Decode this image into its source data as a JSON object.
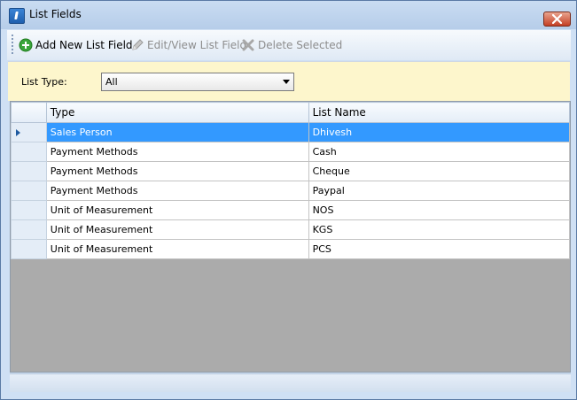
{
  "window": {
    "title": "List Fields",
    "close_label": "Close"
  },
  "toolbar": {
    "add_label": "Add New List Field",
    "edit_label": "Edit/View List Field",
    "delete_label": "Delete Selected"
  },
  "filter": {
    "label": "List Type:",
    "selected": "All"
  },
  "grid": {
    "columns": [
      "Type",
      "List Name"
    ],
    "rows": [
      {
        "type": "Sales Person",
        "name": "Dhivesh",
        "selected": true
      },
      {
        "type": "Payment Methods",
        "name": "Cash"
      },
      {
        "type": "Payment Methods",
        "name": "Cheque"
      },
      {
        "type": "Payment Methods",
        "name": "Paypal"
      },
      {
        "type": "Unit of Measurement",
        "name": "NOS"
      },
      {
        "type": "Unit of Measurement",
        "name": "KGS"
      },
      {
        "type": "Unit of Measurement",
        "name": "PCS"
      }
    ]
  },
  "colors": {
    "selection": "#3399ff",
    "filter_bg": "#fdf6cc",
    "empty_grid": "#ababab"
  }
}
